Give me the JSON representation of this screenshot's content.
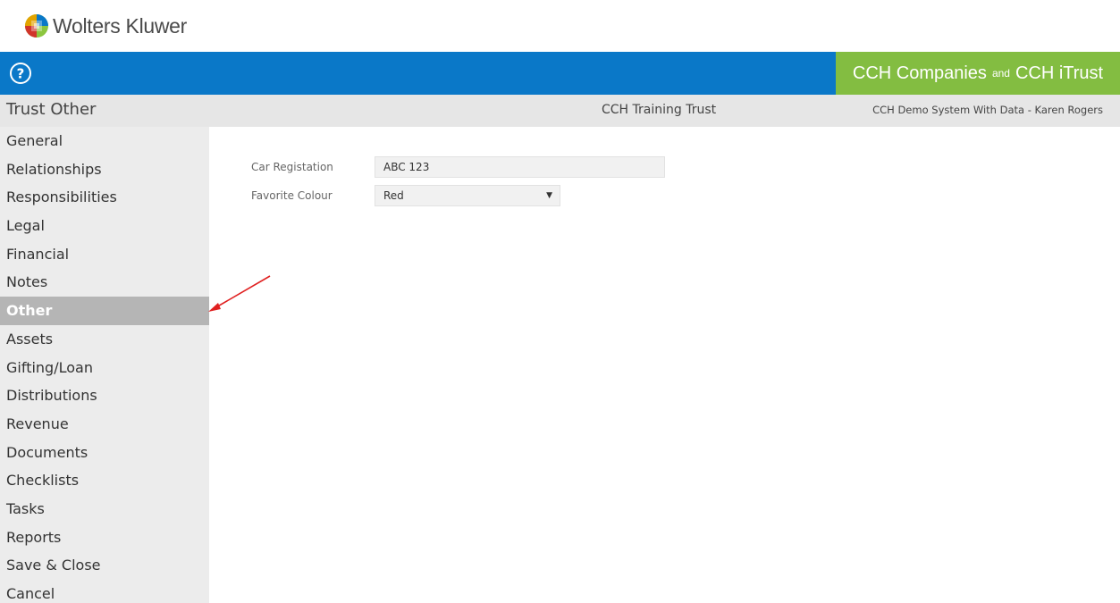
{
  "brand": {
    "company_logo_text": "Wolters Kluwer",
    "product_left": "CCH Companies",
    "product_and": "and",
    "product_right": "CCH iTrust"
  },
  "header": {
    "page_title": "Trust Other",
    "entity_name": "CCH Training Trust",
    "system_info": "CCH Demo System With Data - Karen Rogers"
  },
  "sidebar": {
    "items": [
      {
        "label": "General"
      },
      {
        "label": "Relationships"
      },
      {
        "label": "Responsibilities"
      },
      {
        "label": "Legal"
      },
      {
        "label": "Financial"
      },
      {
        "label": "Notes"
      },
      {
        "label": "Other",
        "active": true
      },
      {
        "label": "Assets"
      },
      {
        "label": "Gifting/Loan"
      },
      {
        "label": "Distributions"
      },
      {
        "label": "Revenue"
      },
      {
        "label": "Documents"
      },
      {
        "label": "Checklists"
      },
      {
        "label": "Tasks"
      },
      {
        "label": "Reports"
      },
      {
        "label": "Save & Close"
      },
      {
        "label": "Cancel"
      }
    ]
  },
  "form": {
    "car_registration_label": "Car Registation",
    "car_registration_value": "ABC 123",
    "favorite_colour_label": "Favorite Colour",
    "favorite_colour_value": "Red"
  },
  "icons": {
    "help": "help-circle-icon",
    "dropdown": "chevron-down-icon"
  },
  "colors": {
    "header_blue": "#0a78c8",
    "brand_green": "#83bd41",
    "active_nav": "#b5b5b5",
    "annotation_red": "#e02020"
  }
}
